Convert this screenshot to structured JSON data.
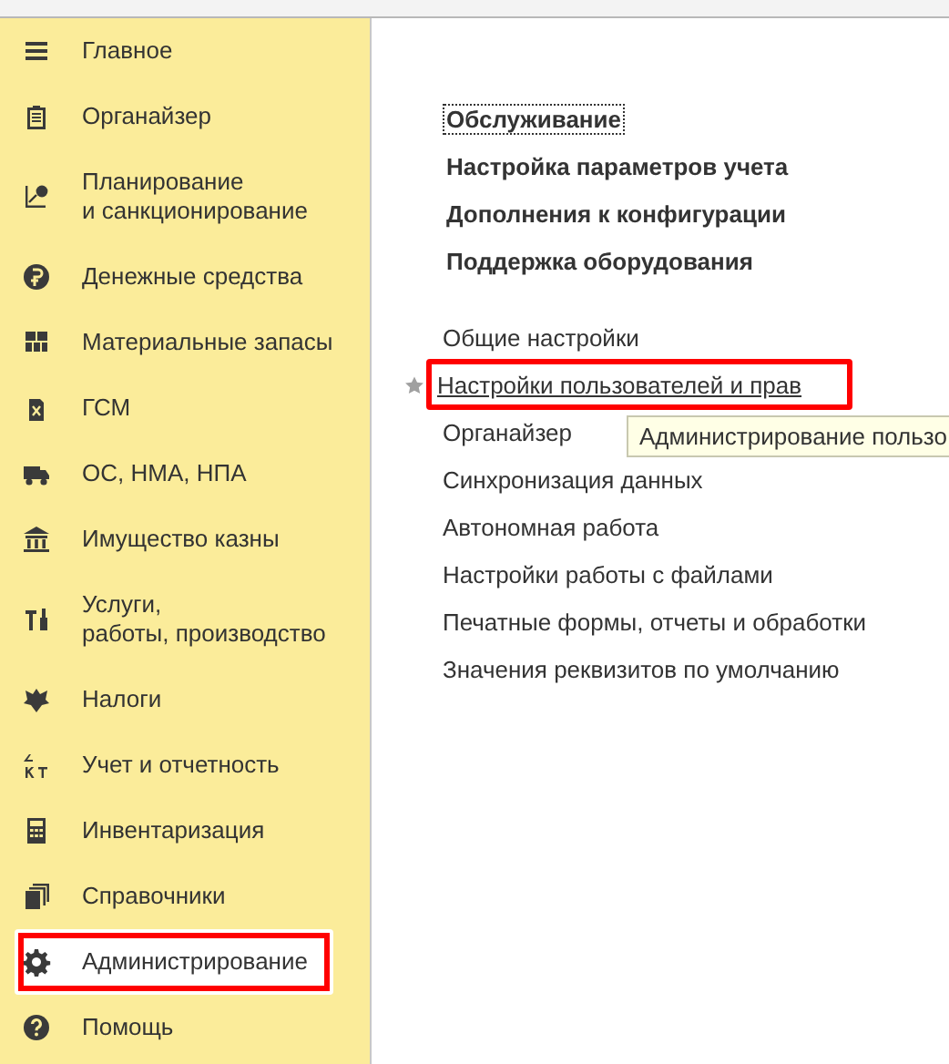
{
  "sidebar": {
    "items": [
      {
        "label": "Главное",
        "selected": false,
        "highlighted": false
      },
      {
        "label": "Органайзер",
        "selected": false,
        "highlighted": false
      },
      {
        "label": "Планирование\nи санкционирование",
        "selected": false,
        "highlighted": false
      },
      {
        "label": "Денежные средства",
        "selected": false,
        "highlighted": false
      },
      {
        "label": "Материальные запасы",
        "selected": false,
        "highlighted": false
      },
      {
        "label": "ГСМ",
        "selected": false,
        "highlighted": false
      },
      {
        "label": "ОС, НМА, НПА",
        "selected": false,
        "highlighted": false
      },
      {
        "label": "Имущество казны",
        "selected": false,
        "highlighted": false
      },
      {
        "label": "Услуги,\nработы, производство",
        "selected": false,
        "highlighted": false
      },
      {
        "label": "Налоги",
        "selected": false,
        "highlighted": false
      },
      {
        "label": "Учет и отчетность",
        "selected": false,
        "highlighted": false
      },
      {
        "label": "Инвентаризация",
        "selected": false,
        "highlighted": false
      },
      {
        "label": "Справочники",
        "selected": false,
        "highlighted": false
      },
      {
        "label": "Администрирование",
        "selected": true,
        "highlighted": true
      },
      {
        "label": "Помощь",
        "selected": false,
        "highlighted": false
      }
    ]
  },
  "content": {
    "sections": [
      {
        "label": "Обслуживание",
        "focused": true
      },
      {
        "label": "Настройка параметров учета",
        "focused": false
      },
      {
        "label": "Дополнения к конфигурации",
        "focused": false
      },
      {
        "label": "Поддержка оборудования",
        "focused": false
      }
    ],
    "links": [
      {
        "label": "Общие настройки",
        "hovered": false,
        "highlighted": false
      },
      {
        "label": "Настройки пользователей и прав",
        "hovered": true,
        "highlighted": true
      },
      {
        "label": "Органайзер",
        "hovered": false,
        "highlighted": false
      },
      {
        "label": "Синхронизация данных",
        "hovered": false,
        "highlighted": false
      },
      {
        "label": "Автономная работа",
        "hovered": false,
        "highlighted": false
      },
      {
        "label": "Настройки работы с файлами",
        "hovered": false,
        "highlighted": false
      },
      {
        "label": "Печатные формы, отчеты и обработки",
        "hovered": false,
        "highlighted": false
      },
      {
        "label": "Значения реквизитов по умолчанию",
        "hovered": false,
        "highlighted": false
      }
    ],
    "tooltip": "Администрирование пользо"
  }
}
